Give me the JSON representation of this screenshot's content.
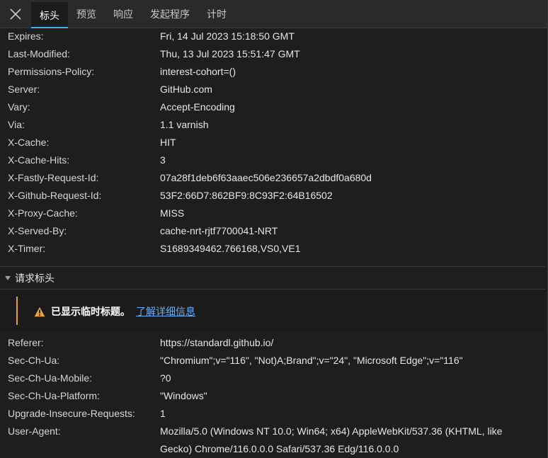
{
  "tabs": [
    {
      "label": "标头",
      "active": true
    },
    {
      "label": "预览",
      "active": false
    },
    {
      "label": "响应",
      "active": false
    },
    {
      "label": "发起程序",
      "active": false
    },
    {
      "label": "计时",
      "active": false
    }
  ],
  "response_headers": [
    {
      "key": "Expires:",
      "value": "Fri, 14 Jul 2023 15:18:50 GMT"
    },
    {
      "key": "Last-Modified:",
      "value": "Thu, 13 Jul 2023 15:51:47 GMT"
    },
    {
      "key": "Permissions-Policy:",
      "value": "interest-cohort=()"
    },
    {
      "key": "Server:",
      "value": "GitHub.com"
    },
    {
      "key": "Vary:",
      "value": "Accept-Encoding"
    },
    {
      "key": "Via:",
      "value": "1.1 varnish"
    },
    {
      "key": "X-Cache:",
      "value": "HIT"
    },
    {
      "key": "X-Cache-Hits:",
      "value": "3"
    },
    {
      "key": "X-Fastly-Request-Id:",
      "value": "07a28f1deb6f63aaec506e236657a2dbdf0a680d"
    },
    {
      "key": "X-Github-Request-Id:",
      "value": "53F2:66D7:862BF9:8C93F2:64B16502"
    },
    {
      "key": "X-Proxy-Cache:",
      "value": "MISS"
    },
    {
      "key": "X-Served-By:",
      "value": "cache-nrt-rjtf7700041-NRT"
    },
    {
      "key": "X-Timer:",
      "value": "S1689349462.766168,VS0,VE1"
    }
  ],
  "request_section": {
    "label": "请求标头"
  },
  "warning": {
    "icon": "warning-icon",
    "color": "#e7a33b",
    "message": "已显示临时标题。",
    "link": "了解详细信息"
  },
  "request_headers": [
    {
      "key": "Referer:",
      "value": "https://standardl.github.io/"
    },
    {
      "key": "Sec-Ch-Ua:",
      "value": "\"Chromium\";v=\"116\", \"Not)A;Brand\";v=\"24\", \"Microsoft Edge\";v=\"116\""
    },
    {
      "key": "Sec-Ch-Ua-Mobile:",
      "value": "?0"
    },
    {
      "key": "Sec-Ch-Ua-Platform:",
      "value": "\"Windows\""
    },
    {
      "key": "Upgrade-Insecure-Requests:",
      "value": "1"
    },
    {
      "key": "User-Agent:",
      "value": "Mozilla/5.0 (Windows NT 10.0; Win64; x64) AppleWebKit/537.36 (KHTML, like Gecko) Chrome/116.0.0.0 Safari/537.36 Edg/116.0.0.0"
    }
  ]
}
